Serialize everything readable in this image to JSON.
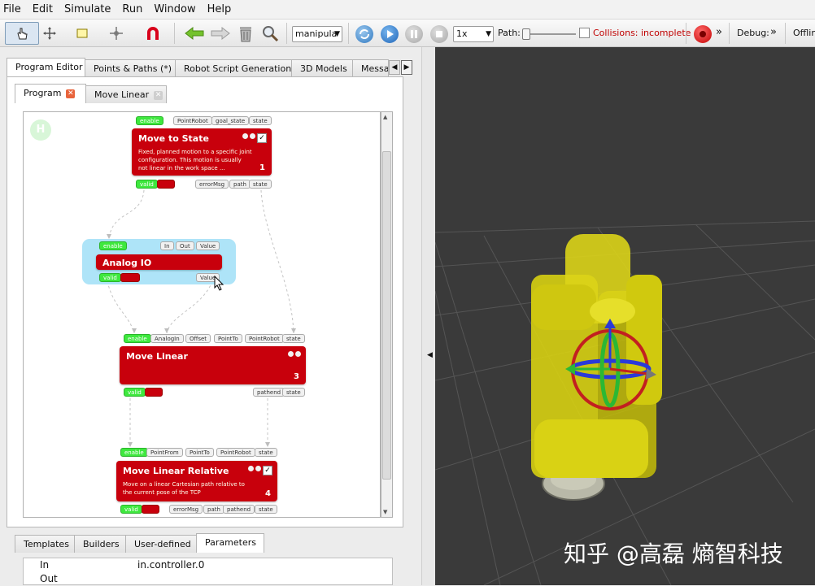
{
  "menu": [
    "File",
    "Edit",
    "Simulate",
    "Run",
    "Window",
    "Help"
  ],
  "toolbar": {
    "manipulator_combo": "manipula",
    "speed_combo": "1x",
    "path_label": "Path:",
    "collisions_label": "Collisions: incomplete",
    "collisions_color": "#c00000",
    "debug_label": "Debug:",
    "offline_label": "Offlin",
    "more_glyph": "»"
  },
  "main_tabs": [
    "Program Editor",
    "Points & Paths (*)",
    "Robot Script Generation",
    "3D Models",
    "Messag"
  ],
  "sub_tabs": [
    "Program",
    "Move Linear"
  ],
  "nodes": {
    "move_to_state": {
      "title": "Move to State",
      "desc": "Fixed, planned motion to a specific joint configuration. This motion is usually not linear in the work space ...",
      "num": "1",
      "in_ports": [
        "enable",
        "PointRobot",
        "goal_state",
        "state"
      ],
      "out_ports": [
        "valid",
        "",
        "errorMsg",
        "path",
        "state"
      ]
    },
    "analog_io": {
      "title": "Analog IO",
      "in_ports": [
        "enable",
        "In",
        "Out",
        "Value"
      ],
      "out_ports": [
        "valid",
        "",
        "Value"
      ]
    },
    "move_linear": {
      "title": "Move Linear",
      "num": "3",
      "in_ports": [
        "enable",
        "AnalogIn",
        "Offset",
        "PointTo",
        "PointRobot",
        "state"
      ],
      "out_ports": [
        "valid",
        "",
        "pathend",
        "state"
      ]
    },
    "move_linear_relative": {
      "title": "Move Linear Relative",
      "desc": "Move on a linear Cartesian path relative to the current pose of the TCP",
      "num": "4",
      "in_ports": [
        "enable",
        "PointFrom",
        "PointTo",
        "PointRobot",
        "state"
      ],
      "out_ports": [
        "valid",
        "",
        "errorMsg",
        "path",
        "pathend",
        "state"
      ]
    }
  },
  "bottom_tabs": [
    "Templates",
    "Builders",
    "User-defined",
    "Parameters"
  ],
  "params": [
    {
      "key": "In",
      "value": "in.controller.0"
    },
    {
      "key": "Out",
      "value": ""
    }
  ],
  "watermark": "知乎 @高磊 熵智科技",
  "colors": {
    "node_red": "#c8000c",
    "port_green": "#3ee83e",
    "analog_bg": "#aee4f8",
    "viewport_bg": "#3a3a3a",
    "robot_yellow": "#d7d012"
  }
}
